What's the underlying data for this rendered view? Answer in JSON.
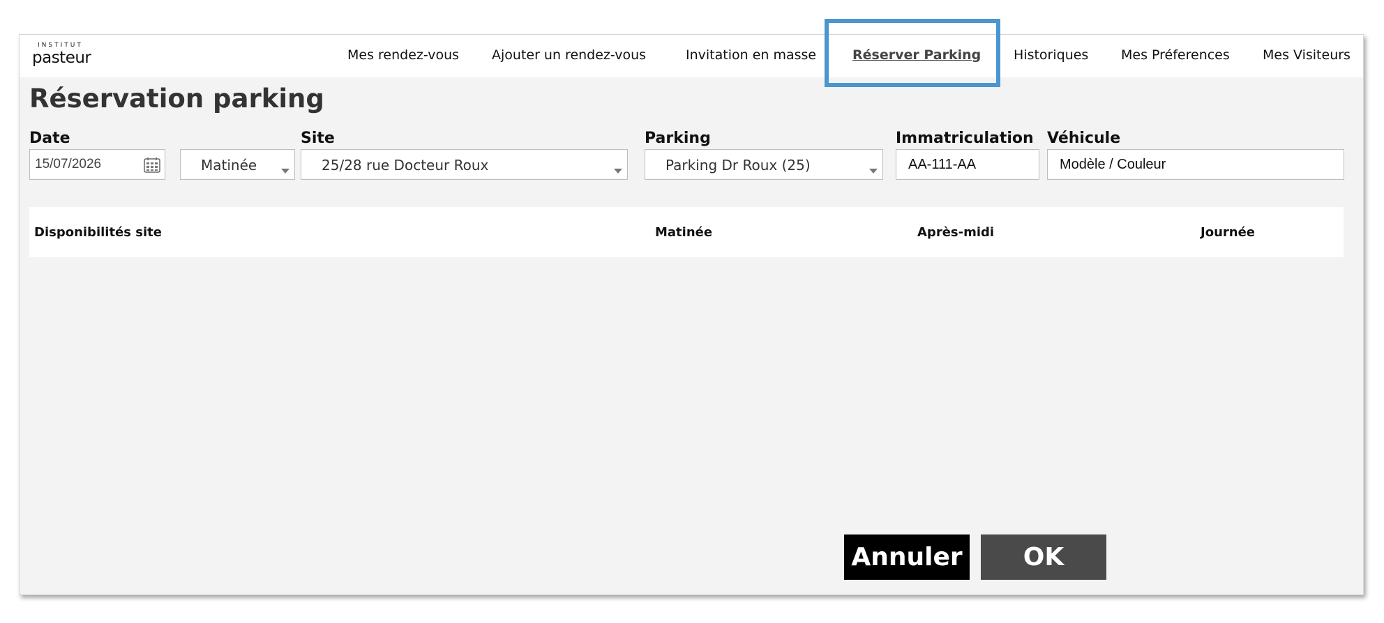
{
  "brand": {
    "line1": "INSTITUT",
    "line2": "pasteur"
  },
  "nav": [
    {
      "label": "Mes rendez-vous"
    },
    {
      "label": "Ajouter un rendez-vous"
    },
    {
      "label": "Invitation en masse"
    },
    {
      "label": "Réserver Parking",
      "active": true
    },
    {
      "label": "Historiques"
    },
    {
      "label": "Mes Préferences"
    },
    {
      "label": "Mes Visiteurs"
    }
  ],
  "page_title": "Réservation parking",
  "form": {
    "date": {
      "label": "Date",
      "value": "15/07/2026",
      "icon": "calendar-icon"
    },
    "period": {
      "value": "Matinée"
    },
    "site": {
      "label": "Site",
      "value": "25/28 rue Docteur Roux"
    },
    "parking": {
      "label": "Parking",
      "value": "Parking Dr Roux (25)"
    },
    "immatriculation": {
      "label": "Immatriculation",
      "value": "AA-111-AA"
    },
    "vehicule": {
      "label": "Véhicule",
      "value": "Modèle / Couleur"
    }
  },
  "availability": {
    "columns": [
      "Disponibilités site",
      "Matinée",
      "Après-midi",
      "Journée"
    ]
  },
  "buttons": {
    "cancel": "Annuler",
    "ok": "OK"
  },
  "colors": {
    "highlight": "#4a96cf",
    "cancel_bg": "#000000",
    "ok_bg": "#4a4a4a"
  }
}
